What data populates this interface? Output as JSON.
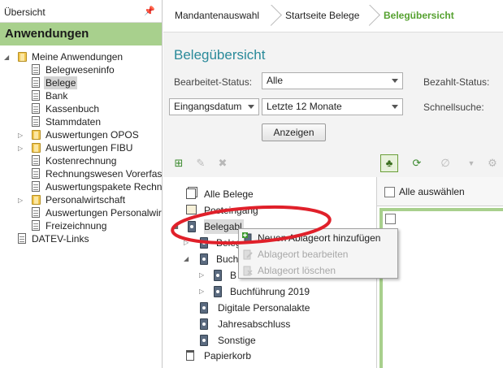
{
  "left_panel": {
    "title": "Übersicht",
    "pin_symbol": "𝄩",
    "header": "Anwendungen",
    "items": [
      {
        "label": "Meine Anwendungen",
        "icon": "folder-icon",
        "expanded": true
      },
      {
        "label": "Belegweseninfo",
        "icon": "document-icon"
      },
      {
        "label": "Belege",
        "icon": "document-icon",
        "selected": true
      },
      {
        "label": "Bank",
        "icon": "document-icon"
      },
      {
        "label": "Kassenbuch",
        "icon": "document-icon"
      },
      {
        "label": "Stammdaten",
        "icon": "document-icon"
      },
      {
        "label": "Auswertungen OPOS",
        "icon": "folder-icon",
        "expandable": true
      },
      {
        "label": "Auswertungen FIBU",
        "icon": "folder-icon",
        "expandable": true
      },
      {
        "label": "Kostenrechnung",
        "icon": "document-icon"
      },
      {
        "label": "Rechnungswesen Vorerfass",
        "icon": "document-icon"
      },
      {
        "label": "Auswertungspakete Rechnu",
        "icon": "document-icon"
      },
      {
        "label": "Personalwirtschaft",
        "icon": "folder-icon",
        "expandable": true
      },
      {
        "label": "Auswertungen Personalwirt",
        "icon": "document-icon"
      },
      {
        "label": "Freizeichnung",
        "icon": "document-icon"
      },
      {
        "label": "DATEV-Links",
        "icon": "document-icon"
      }
    ]
  },
  "breadcrumbs": [
    "Mandantenauswahl",
    "Startseite Belege",
    "Belegübersicht"
  ],
  "page_title": "Belegübersicht",
  "filters": {
    "bearbeitet_label": "Bearbeitet-Status:",
    "bearbeitet_value": "Alle",
    "bezahlt_label": "Bezahlt-Status:",
    "date_field_value": "Eingangsdatum",
    "period_value": "Letzte 12 Monate",
    "schnellsuche_label": "Schnellsuche:",
    "show_button": "Anzeigen"
  },
  "toolbar_icons": [
    "add-storage-icon",
    "edit-storage-icon",
    "delete-storage-icon",
    "tree-view-icon",
    "refresh-icon",
    "attachment-icon",
    "dropdown-icon",
    "settings-icon"
  ],
  "tree": {
    "items": [
      {
        "label": "Alle Belege",
        "icon": "stack-icon"
      },
      {
        "label": "Posteingang",
        "icon": "inbox-icon"
      },
      {
        "label": "Belegabl",
        "icon": "binder-icon",
        "selected": true
      },
      {
        "label": "Beleg",
        "icon": "binder-icon"
      },
      {
        "label": "Buch",
        "icon": "binder-icon"
      },
      {
        "label": "B",
        "icon": "binder-icon"
      },
      {
        "label": "Buchführung 2019",
        "icon": "binder-icon"
      },
      {
        "label": "Digitale Personalakte",
        "icon": "binder-icon"
      },
      {
        "label": "Jahresabschluss",
        "icon": "binder-icon"
      },
      {
        "label": "Sonstige",
        "icon": "binder-icon"
      },
      {
        "label": "Papierkorb",
        "icon": "trash-icon"
      }
    ]
  },
  "grid": {
    "select_all_label": "Alle auswählen"
  },
  "context_menu": {
    "items": [
      {
        "label": "Neuen Ablageort hinzufügen",
        "enabled": true
      },
      {
        "label": "Ablageort bearbeiten",
        "enabled": false
      },
      {
        "label": "Ablageort löschen",
        "enabled": false
      }
    ]
  },
  "colors": {
    "accent_green": "#a8d08d",
    "title_teal": "#2a8a9a",
    "breadcrumb_active": "#55a12f",
    "annotation_red": "#e0202a"
  }
}
